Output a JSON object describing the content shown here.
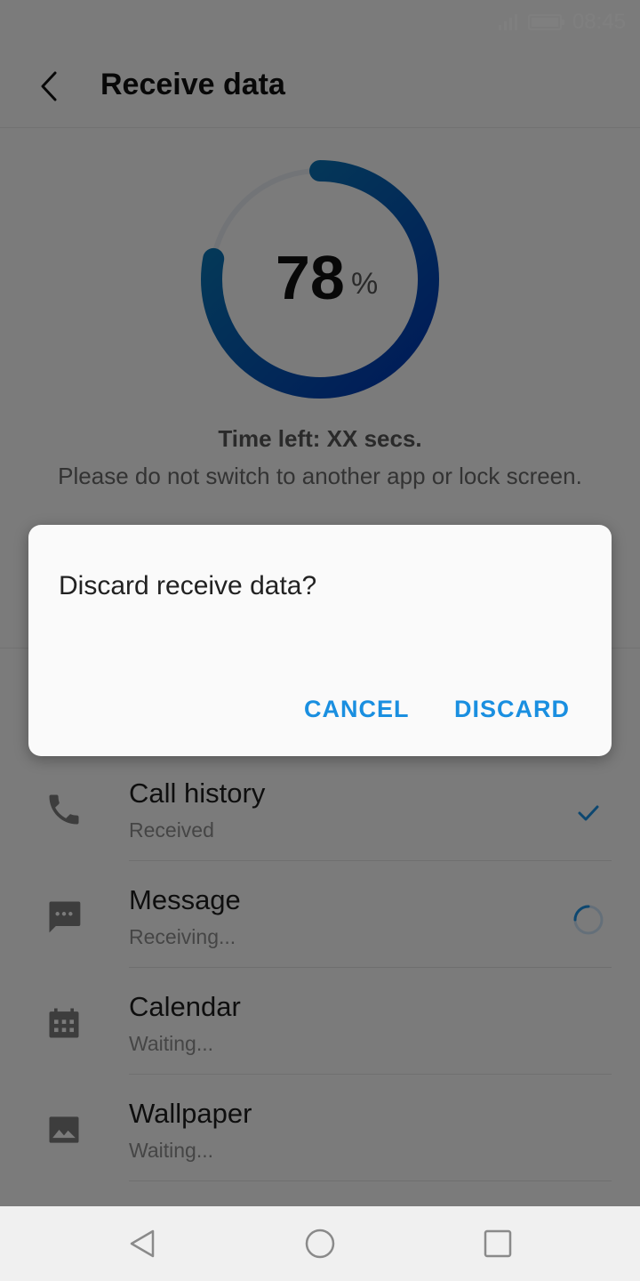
{
  "status": {
    "time": "08:45",
    "battery_level": 1.0
  },
  "header": {
    "title": "Receive data"
  },
  "progress": {
    "value": 78,
    "percent_symbol": "%",
    "color_start": "#0b7fb0",
    "color_end": "#0033b0"
  },
  "info": {
    "time_left": "Time left: XX secs.",
    "notice": "Please do not switch to another app or lock screen."
  },
  "items": [
    {
      "name": "Call history",
      "status": "Received",
      "state": "done",
      "icon": "phone-icon"
    },
    {
      "name": "Message",
      "status": "Receiving...",
      "state": "loading",
      "icon": "message-icon"
    },
    {
      "name": "Calendar",
      "status": "Waiting...",
      "state": "waiting",
      "icon": "calendar-icon"
    },
    {
      "name": "Wallpaper",
      "status": "Waiting...",
      "state": "waiting",
      "icon": "image-icon"
    }
  ],
  "dialog": {
    "message": "Discard receive data?",
    "cancel": "CANCEL",
    "discard": "DISCARD"
  },
  "colors": {
    "accent": "#1a8fe0"
  }
}
